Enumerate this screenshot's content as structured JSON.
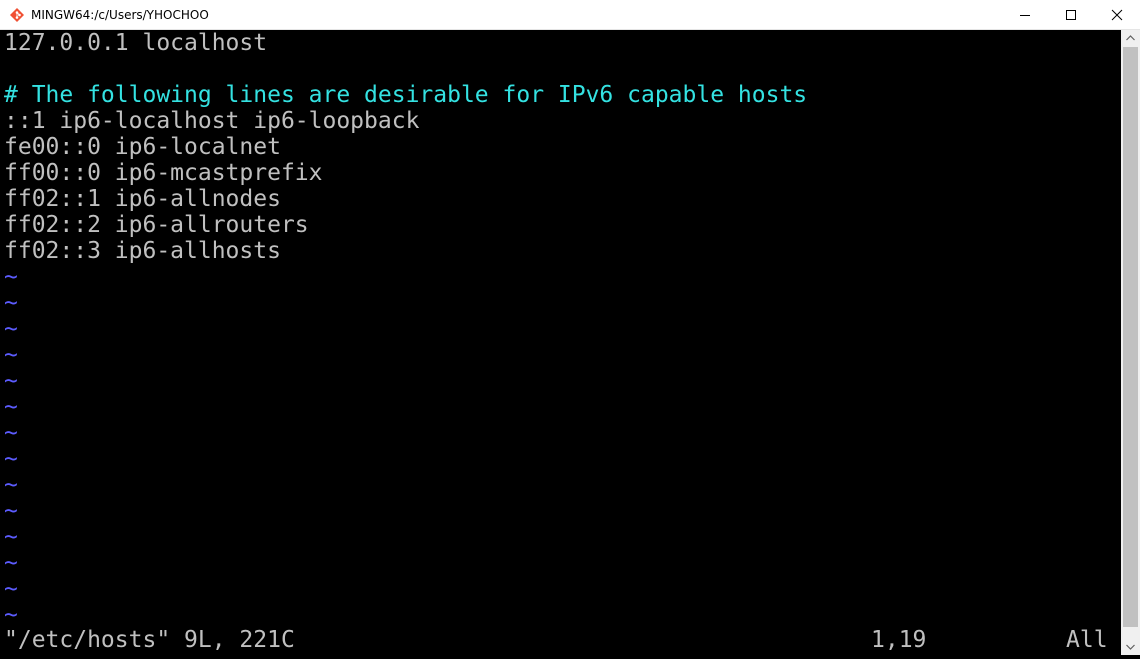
{
  "window": {
    "title": "MINGW64:/c/Users/YHOCHOO"
  },
  "icons": {
    "app": "git-diamond-icon",
    "minimize": "minimize-icon",
    "maximize": "maximize-icon",
    "close": "close-icon"
  },
  "colors": {
    "background": "#000000",
    "text": "#c0c0c0",
    "comment": "#34e2e2",
    "tilde": "#5c5cff"
  },
  "editor": {
    "lines": [
      "127.0.0.1 localhost",
      "",
      "# The following lines are desirable for IPv6 capable hosts",
      "::1 ip6-localhost ip6-loopback",
      "fe00::0 ip6-localnet",
      "ff00::0 ip6-mcastprefix",
      "ff02::1 ip6-allnodes",
      "ff02::2 ip6-allrouters",
      "ff02::3 ip6-allhosts"
    ],
    "empty_marker": "~",
    "empty_line_count": 14
  },
  "statusline": {
    "file_info": "\"/etc/hosts\" 9L, 221C",
    "cursor_position": "1,19",
    "scroll_position": "All"
  }
}
